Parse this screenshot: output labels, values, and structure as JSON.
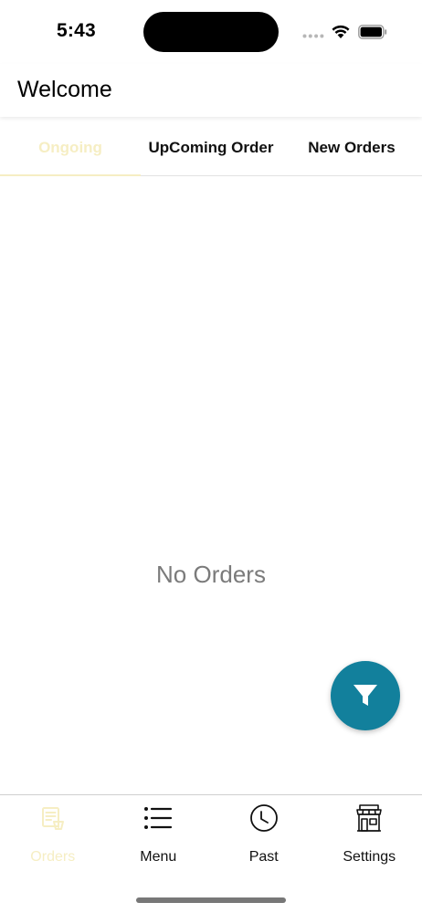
{
  "status_bar": {
    "time": "5:43"
  },
  "header": {
    "title": "Welcome"
  },
  "tabs": [
    {
      "label": "Ongoing",
      "active": true
    },
    {
      "label": "UpComing Order",
      "active": false
    },
    {
      "label": "New Orders",
      "active": false
    }
  ],
  "main": {
    "empty_message": "No Orders"
  },
  "fab": {
    "icon": "filter-icon"
  },
  "bottom_nav": [
    {
      "label": "Orders",
      "icon": "orders-icon",
      "active": true
    },
    {
      "label": "Menu",
      "icon": "list-icon",
      "active": false
    },
    {
      "label": "Past",
      "icon": "clock-icon",
      "active": false
    },
    {
      "label": "Settings",
      "icon": "store-icon",
      "active": false
    }
  ],
  "colors": {
    "accent_active": "#f6eec3",
    "fab": "#12809c",
    "muted_text": "#7b7b7b"
  }
}
